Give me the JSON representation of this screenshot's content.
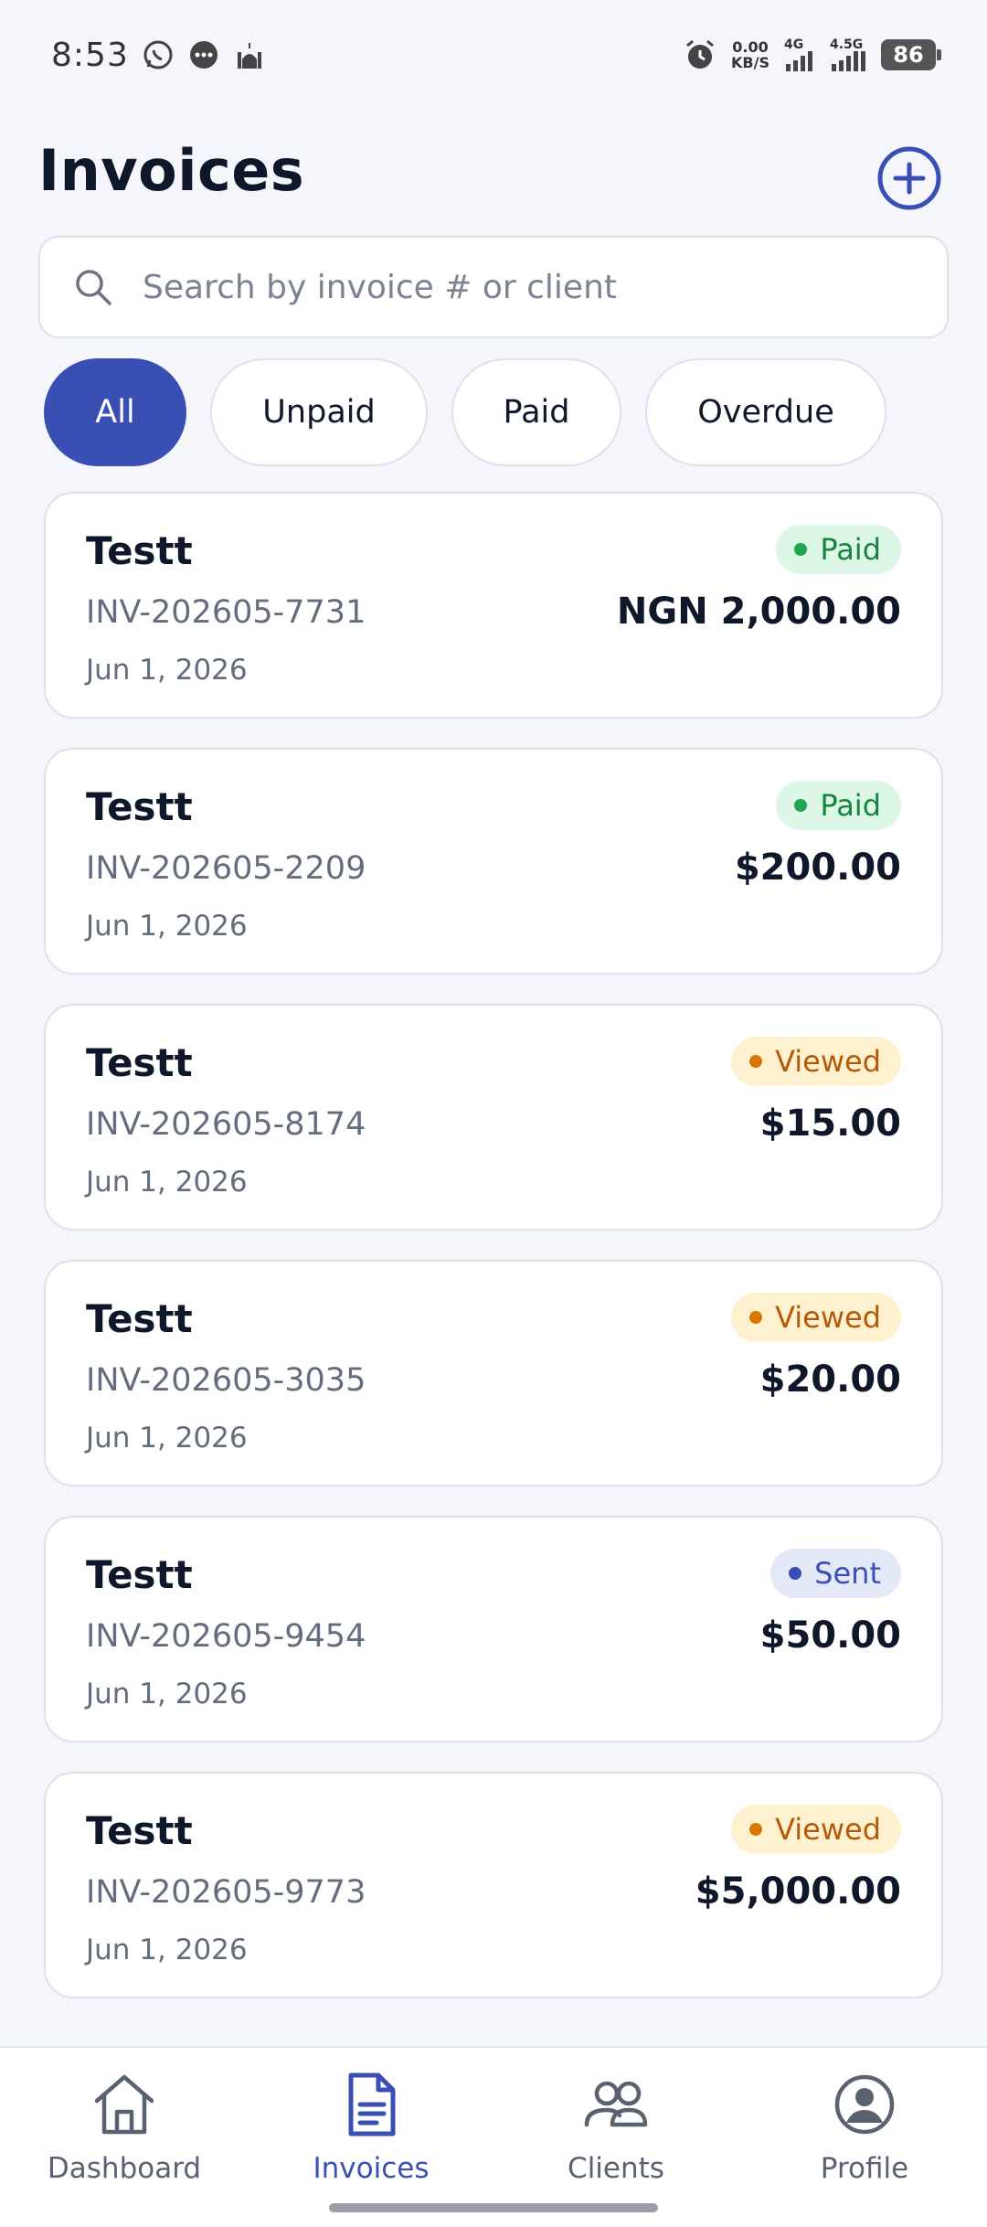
{
  "status_bar": {
    "time": "8:53",
    "net_speed_value": "0.00",
    "net_speed_unit": "KB/S",
    "signal_1": "4G",
    "signal_2": "4.5G",
    "battery": "86"
  },
  "header": {
    "title": "Invoices"
  },
  "search": {
    "placeholder": "Search by invoice # or client",
    "value": ""
  },
  "filters": [
    {
      "label": "All",
      "active": true
    },
    {
      "label": "Unpaid",
      "active": false
    },
    {
      "label": "Paid",
      "active": false
    },
    {
      "label": "Overdue",
      "active": false
    }
  ],
  "invoices": [
    {
      "client": "Testt",
      "number": "INV-202605-7731",
      "date": "Jun 1, 2026",
      "amount": "NGN 2,000.00",
      "status": "Paid"
    },
    {
      "client": "Testt",
      "number": "INV-202605-2209",
      "date": "Jun 1, 2026",
      "amount": "$200.00",
      "status": "Paid"
    },
    {
      "client": "Testt",
      "number": "INV-202605-8174",
      "date": "Jun 1, 2026",
      "amount": "$15.00",
      "status": "Viewed"
    },
    {
      "client": "Testt",
      "number": "INV-202605-3035",
      "date": "Jun 1, 2026",
      "amount": "$20.00",
      "status": "Viewed"
    },
    {
      "client": "Testt",
      "number": "INV-202605-9454",
      "date": "Jun 1, 2026",
      "amount": "$50.00",
      "status": "Sent"
    },
    {
      "client": "Testt",
      "number": "INV-202605-9773",
      "date": "Jun 1, 2026",
      "amount": "$5,000.00",
      "status": "Viewed"
    }
  ],
  "status_colors": {
    "Paid": {
      "bg": "#dcf7e5",
      "fg": "#16833f",
      "dot": "#1ea34f"
    },
    "Viewed": {
      "bg": "#fdf1cf",
      "fg": "#b45a09",
      "dot": "#d97706"
    },
    "Sent": {
      "bg": "#e4e9f8",
      "fg": "#3a4fb3",
      "dot": "#3a4fb3"
    }
  },
  "nav": {
    "items": [
      {
        "label": "Dashboard",
        "icon": "home-icon"
      },
      {
        "label": "Invoices",
        "icon": "document-icon"
      },
      {
        "label": "Clients",
        "icon": "users-icon"
      },
      {
        "label": "Profile",
        "icon": "profile-icon"
      }
    ],
    "active_index": 1
  },
  "colors": {
    "accent": "#3a4fb3",
    "background": "#f4f6fb",
    "card": "#ffffff"
  }
}
